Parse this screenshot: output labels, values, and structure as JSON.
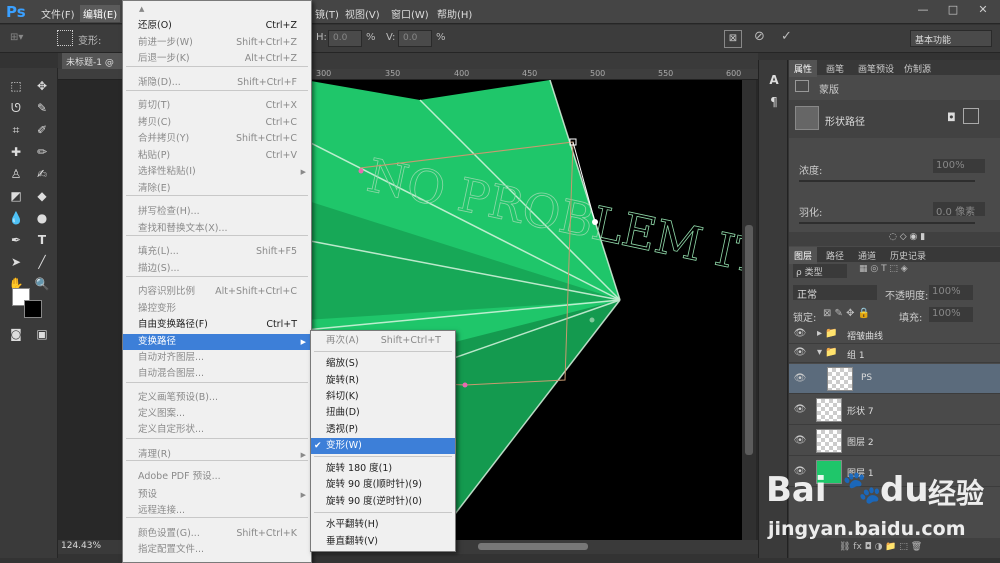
{
  "app": {
    "logo": "Ps"
  },
  "menubar": {
    "items": [
      "文件(F)",
      "编辑(E)",
      "镜(T)",
      "视图(V)",
      "窗口(W)",
      "帮助(H)"
    ],
    "window_controls": [
      "—",
      "□",
      "✕"
    ]
  },
  "optionsbar": {
    "transform_label": "变形:",
    "h_label": "H:",
    "h_value": "0.0",
    "h_unit": "%",
    "v_label": "V:",
    "v_value": "0.0",
    "v_unit": "%",
    "workspace": "基本功能"
  },
  "document": {
    "tab": "未标题-1 @",
    "zoom": "124.43%",
    "ruler_ticks": [
      "300",
      "350",
      "400",
      "450",
      "500",
      "550",
      "600"
    ]
  },
  "right_panel": {
    "props_tabs": [
      "属性",
      "画笔",
      "画笔预设",
      "仿制源"
    ],
    "mask_label": "蒙版",
    "shape_path_label": "形状路径",
    "density_label": "浓度:",
    "density_value": "100%",
    "feather_label": "羽化:",
    "feather_value": "0.0 像素",
    "layers_tabs": [
      "图层",
      "路径",
      "通道",
      "历史记录"
    ],
    "filter_kind": "ρ 类型",
    "blend_mode": "正常",
    "opacity_label": "不透明度:",
    "opacity_value": "100%",
    "lock_label": "锁定:",
    "fill_label": "填充:",
    "fill_value": "100%",
    "layers": [
      {
        "name": "褶皱曲线",
        "type": "group"
      },
      {
        "name": "组 1",
        "type": "group"
      },
      {
        "name": "PS",
        "type": "layer"
      },
      {
        "name": "形状 7",
        "type": "layer"
      },
      {
        "name": "图层 2",
        "type": "layer"
      },
      {
        "name": "图层 1",
        "type": "layer"
      }
    ]
  },
  "canvas": {
    "watermark_text": "NO PROBLEM IT'S DS"
  },
  "edit_menu": {
    "items": [
      {
        "label": "还原(O)",
        "shortcut": "Ctrl+Z",
        "state": "enabled"
      },
      {
        "label": "前进一步(W)",
        "shortcut": "Shift+Ctrl+Z",
        "state": "disabled"
      },
      {
        "label": "后退一步(K)",
        "shortcut": "Alt+Ctrl+Z",
        "state": "disabled"
      },
      {
        "label": "渐隐(D)...",
        "shortcut": "Shift+Ctrl+F",
        "state": "disabled"
      },
      {
        "label": "剪切(T)",
        "shortcut": "Ctrl+X",
        "state": "disabled"
      },
      {
        "label": "拷贝(C)",
        "shortcut": "Ctrl+C",
        "state": "disabled"
      },
      {
        "label": "合并拷贝(Y)",
        "shortcut": "Shift+Ctrl+C",
        "state": "disabled"
      },
      {
        "label": "粘贴(P)",
        "shortcut": "Ctrl+V",
        "state": "disabled"
      },
      {
        "label": "选择性粘贴(I)",
        "shortcut": "",
        "state": "disabled"
      },
      {
        "label": "清除(E)",
        "shortcut": "",
        "state": "disabled"
      },
      {
        "label": "拼写检查(H)...",
        "shortcut": "",
        "state": "disabled"
      },
      {
        "label": "查找和替换文本(X)...",
        "shortcut": "",
        "state": "disabled"
      },
      {
        "label": "填充(L)...",
        "shortcut": "Shift+F5",
        "state": "disabled"
      },
      {
        "label": "描边(S)...",
        "shortcut": "",
        "state": "disabled"
      },
      {
        "label": "内容识别比例",
        "shortcut": "Alt+Shift+Ctrl+C",
        "state": "disabled"
      },
      {
        "label": "操控变形",
        "shortcut": "",
        "state": "disabled"
      },
      {
        "label": "自由变换路径(F)",
        "shortcut": "Ctrl+T",
        "state": "enabled"
      },
      {
        "label": "变换路径",
        "shortcut": "",
        "state": "highlighted"
      },
      {
        "label": "自动对齐图层...",
        "shortcut": "",
        "state": "disabled"
      },
      {
        "label": "自动混合图层...",
        "shortcut": "",
        "state": "disabled"
      },
      {
        "label": "定义画笔预设(B)...",
        "shortcut": "",
        "state": "disabled"
      },
      {
        "label": "定义图案...",
        "shortcut": "",
        "state": "disabled"
      },
      {
        "label": "定义自定形状...",
        "shortcut": "",
        "state": "disabled"
      },
      {
        "label": "清理(R)",
        "shortcut": "",
        "state": "disabled"
      },
      {
        "label": "Adobe PDF 预设...",
        "shortcut": "",
        "state": "disabled"
      },
      {
        "label": "预设",
        "shortcut": "",
        "state": "disabled"
      },
      {
        "label": "远程连接...",
        "shortcut": "",
        "state": "disabled"
      },
      {
        "label": "颜色设置(G)...",
        "shortcut": "Shift+Ctrl+K",
        "state": "disabled"
      },
      {
        "label": "指定配置文件...",
        "shortcut": "",
        "state": "disabled"
      }
    ]
  },
  "transform_submenu": {
    "items": [
      {
        "label": "再次(A)",
        "shortcut": "Shift+Ctrl+T",
        "state": "disabled"
      },
      {
        "label": "缩放(S)",
        "shortcut": "",
        "state": "enabled"
      },
      {
        "label": "旋转(R)",
        "shortcut": "",
        "state": "enabled"
      },
      {
        "label": "斜切(K)",
        "shortcut": "",
        "state": "enabled"
      },
      {
        "label": "扭曲(D)",
        "shortcut": "",
        "state": "enabled"
      },
      {
        "label": "透视(P)",
        "shortcut": "",
        "state": "enabled"
      },
      {
        "label": "变形(W)",
        "shortcut": "",
        "state": "highlighted",
        "checked": "✔"
      },
      {
        "label": "旋转 180 度(1)",
        "shortcut": "",
        "state": "enabled"
      },
      {
        "label": "旋转 90 度(顺时针)(9)",
        "shortcut": "",
        "state": "enabled"
      },
      {
        "label": "旋转 90 度(逆时针)(0)",
        "shortcut": "",
        "state": "enabled"
      },
      {
        "label": "水平翻转(H)",
        "shortcut": "",
        "state": "enabled"
      },
      {
        "label": "垂直翻转(V)",
        "shortcut": "",
        "state": "enabled"
      }
    ]
  },
  "watermark": {
    "brand": "Bai",
    "brand2": "du",
    "cn": "经验",
    "url": "jingyan.baidu.com"
  },
  "colors": {
    "accent": "#3d7fd8",
    "green": "#1fc66a",
    "ps_blue": "#3aa0ff"
  }
}
